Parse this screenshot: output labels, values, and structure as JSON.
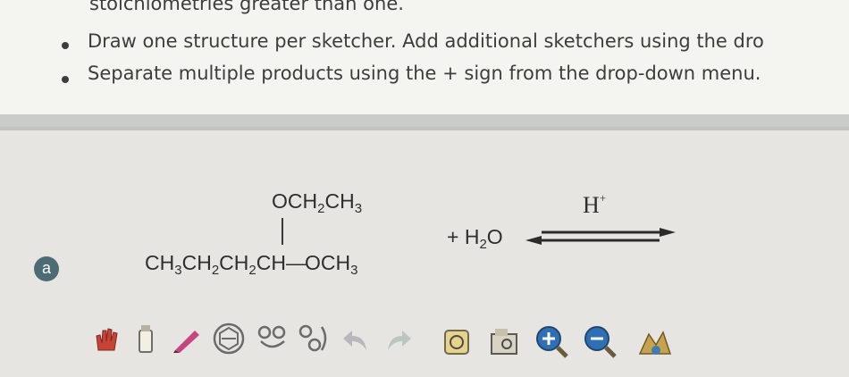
{
  "instructions": {
    "line0": "stoichiometries greater than one.",
    "bullet1": "Draw one structure per sketcher. Add additional sketchers using the dro",
    "bullet2": "Separate multiple products using the + sign from the drop-down menu."
  },
  "problem": {
    "label": "a",
    "reactant_top": {
      "base1": "OCH",
      "sub1": "2",
      "base2": "CH",
      "sub2": "3"
    },
    "reactant_main": {
      "p1": "CH",
      "s1": "3",
      "p2": "CH",
      "s2": "2",
      "p3": "CH",
      "s3": "2",
      "p4": "CH",
      "bond": "—",
      "p5": "OCH",
      "s5": "3"
    },
    "plus_water": {
      "prefix": "+ H",
      "sub": "2",
      "suffix": "O"
    },
    "catalyst": "H",
    "catalyst_sup": "+"
  },
  "toolbar": {
    "tools": [
      "hand-tool",
      "erase-tool",
      "pencil-tool",
      "ring-template-tool",
      "molecule-template-tool",
      "chain-tool",
      "undo",
      "redo",
      "clean-structure",
      "import-structure",
      "zoom-in",
      "zoom-out",
      "help"
    ]
  },
  "colors": {
    "badge": "#4d6b74",
    "zoom_in": "#2f6fb4",
    "zoom_out": "#2f6fb4",
    "hand": "#c0392b"
  }
}
